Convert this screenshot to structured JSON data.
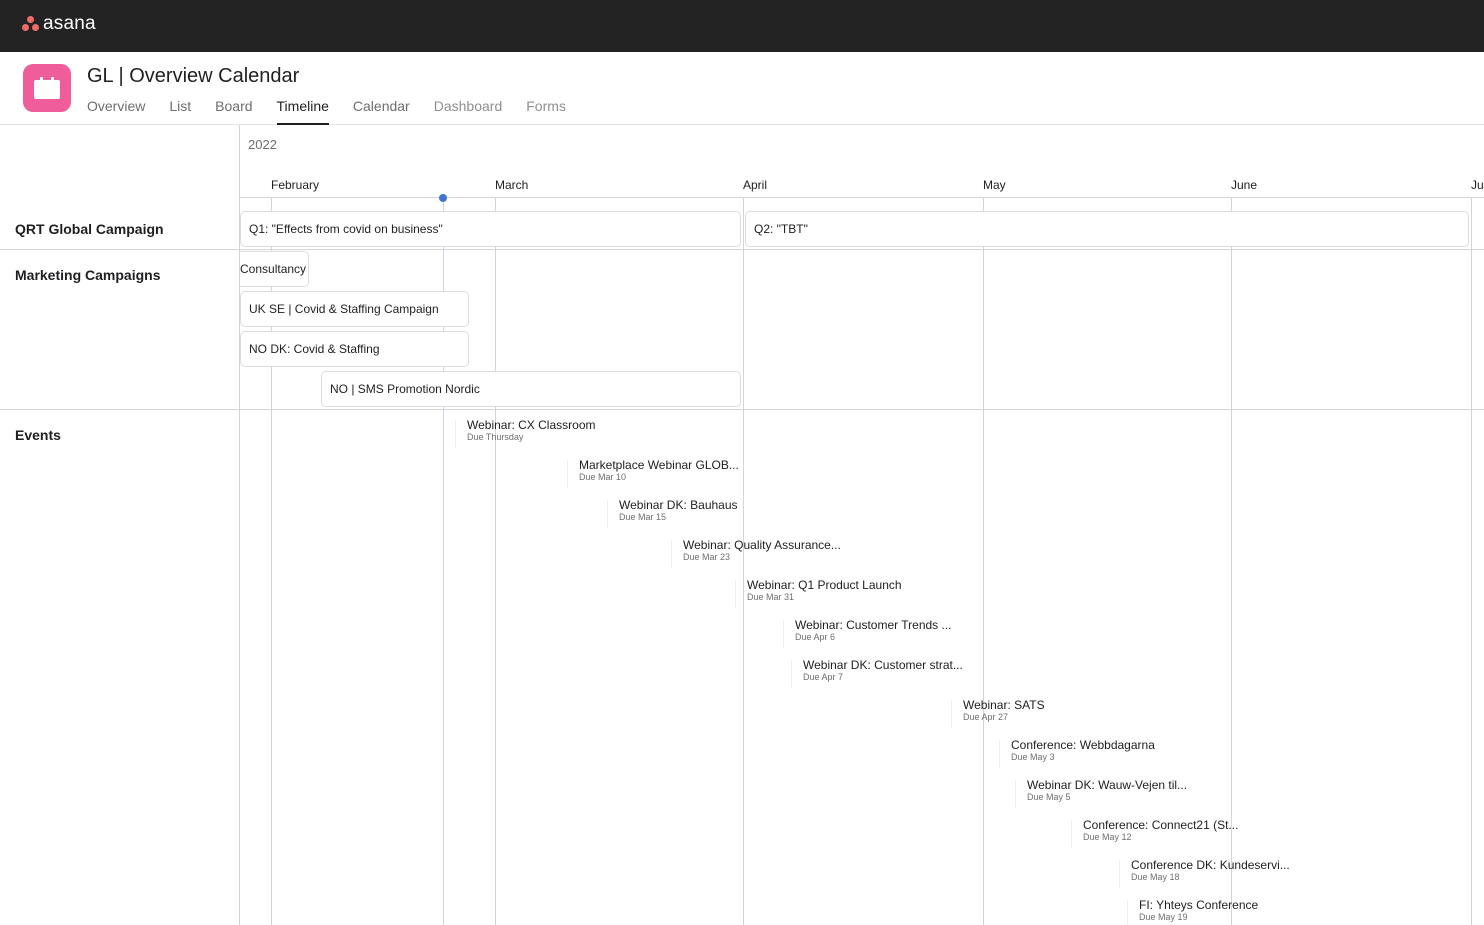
{
  "app": {
    "logo_text": "asana",
    "logo_dot_color": "#f06a6a"
  },
  "project": {
    "title": "GL | Overview Calendar",
    "icon": "calendar-icon",
    "icon_color": "#ef5d9a",
    "tabs": [
      {
        "label": "Overview",
        "active": false
      },
      {
        "label": "List",
        "active": false
      },
      {
        "label": "Board",
        "active": false
      },
      {
        "label": "Timeline",
        "active": true
      },
      {
        "label": "Calendar",
        "active": false
      },
      {
        "label": "Dashboard",
        "active": false
      },
      {
        "label": "Forms",
        "active": false
      }
    ]
  },
  "timeline": {
    "year": "2022",
    "months": [
      "February",
      "March",
      "April",
      "May",
      "June",
      "Ju"
    ],
    "today_marker_color": "#4573d2",
    "groups": [
      {
        "label": "QRT Global Campaign",
        "bars": [
          {
            "label": "Q1: \"Effects from covid on business\""
          },
          {
            "label": "Q2: \"TBT\""
          }
        ]
      },
      {
        "label": "Marketing Campaigns",
        "bars": [
          {
            "label": "Consultancy"
          },
          {
            "label": "UK SE | Covid & Staffing Campaign"
          },
          {
            "label": "NO DK: Covid & Staffing"
          },
          {
            "label": "NO | SMS Promotion Nordic"
          }
        ]
      },
      {
        "label": "Events",
        "events": [
          {
            "title": "Webinar: CX Classroom",
            "due": "Due Thursday"
          },
          {
            "title": "Marketplace Webinar GLOB...",
            "due": "Due Mar 10"
          },
          {
            "title": "Webinar DK: Bauhaus",
            "due": "Due Mar 15"
          },
          {
            "title": "Webinar: Quality Assurance...",
            "due": "Due Mar 23"
          },
          {
            "title": "Webinar: Q1 Product Launch",
            "due": "Due Mar 31"
          },
          {
            "title": "Webinar: Customer Trends ...",
            "due": "Due Apr 6"
          },
          {
            "title": "Webinar DK: Customer strat...",
            "due": "Due Apr 7"
          },
          {
            "title": "Webinar: SATS",
            "due": "Due Apr 27"
          },
          {
            "title": "Conference: Webbdagarna",
            "due": "Due May 3"
          },
          {
            "title": "Webinar DK: Wauw-Vejen til...",
            "due": "Due May 5"
          },
          {
            "title": "Conference: Connect21 (St...",
            "due": "Due May 12"
          },
          {
            "title": "Conference DK: Kundeservi...",
            "due": "Due May 18"
          },
          {
            "title": "FI: Yhteys Conference",
            "due": "Due May 19"
          }
        ]
      }
    ]
  }
}
